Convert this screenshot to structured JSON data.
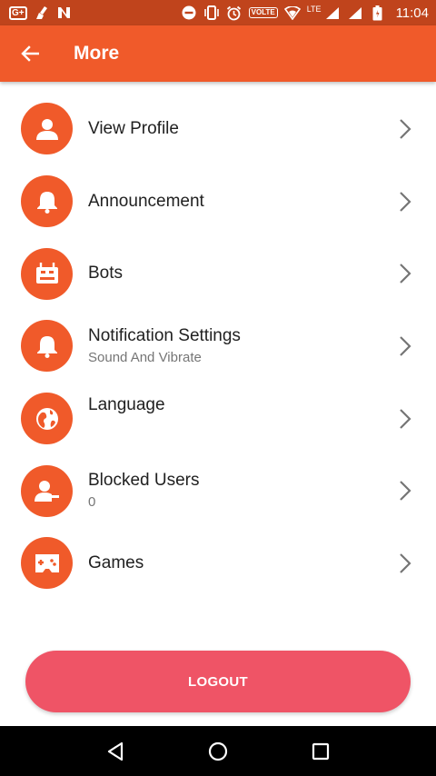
{
  "status_bar": {
    "gplus": "G+",
    "volte": "VOLTE",
    "lte": "LTE",
    "time": "11:04"
  },
  "toolbar": {
    "title": "More",
    "back_icon": "arrow-back-icon",
    "color": "#f05a2a"
  },
  "menu": {
    "items": [
      {
        "label": "View Profile",
        "sublabel": "",
        "icon": "person-icon"
      },
      {
        "label": "Announcement",
        "sublabel": "",
        "icon": "bell-icon"
      },
      {
        "label": "Bots",
        "sublabel": "",
        "icon": "bot-icon"
      },
      {
        "label": "Notification Settings",
        "sublabel": "Sound And Vibrate",
        "icon": "bell-icon"
      },
      {
        "label": "Language",
        "sublabel": "",
        "icon": "globe-icon"
      },
      {
        "label": "Blocked Users",
        "sublabel": "0",
        "icon": "person-blocked-icon"
      },
      {
        "label": "Games",
        "sublabel": "",
        "icon": "gamepad-icon"
      }
    ],
    "icon_color": "#f05a2a"
  },
  "logout": {
    "label": "LOGOUT",
    "color": "#ef5466"
  },
  "nav_bar": {
    "back_icon": "nav-back-icon",
    "home_icon": "nav-home-icon",
    "recents_icon": "nav-recents-icon"
  }
}
